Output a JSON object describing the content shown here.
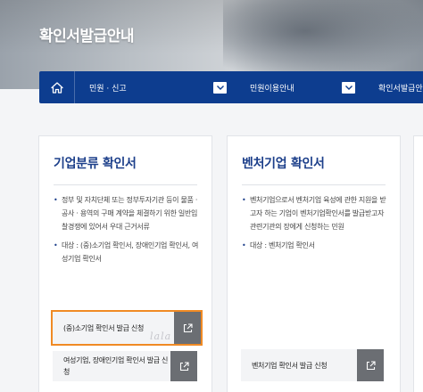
{
  "hero": {
    "title": "확인서발급안내"
  },
  "nav": {
    "home_icon": "home-icon",
    "items": [
      {
        "label": "민원 · 신고"
      },
      {
        "label": "민원이용안내"
      },
      {
        "label": "확인서발급안내"
      }
    ],
    "dropdown_icon": "chevron-down-icon"
  },
  "cards": [
    {
      "title": "기업분류 확인서",
      "bullets": [
        "정부 및 자치단체 또는 정부투자기관 등이 물품 · 공사 · 용역의 구매 계약을 체결하기 위한 일반입찰경쟁에 있어서 우대 근거서류",
        "대상 : (중)소기업 확인서, 장애인기업 확인서, 여성기업 확인서"
      ],
      "buttons": [
        {
          "label": "(중)소기업 확인서 발급 신청",
          "icon": "external-link-icon",
          "highlighted": true
        },
        {
          "label": "여성기업, 장애인기업 확인서 발급 신청",
          "icon": "external-link-icon"
        }
      ]
    },
    {
      "title": "벤처기업 확인서",
      "bullets": [
        "벤처기업으로서 벤처기업 육성에 관한 지원을 받고자 하는 기업이 벤처기업확인서를 발급받고자 관련기관의 장에게 신청하는 민원",
        "대상 : 벤처기업 확인서"
      ],
      "buttons": [
        {
          "label": "벤처기업 확인서 발급 신청",
          "icon": "external-link-icon"
        }
      ]
    }
  ],
  "colors": {
    "nav_bg": "#0d3d8f",
    "title_blue": "#1c3f8a",
    "highlight": "#f08a24",
    "ext_btn": "#6b6e73"
  },
  "watermark": "lala"
}
